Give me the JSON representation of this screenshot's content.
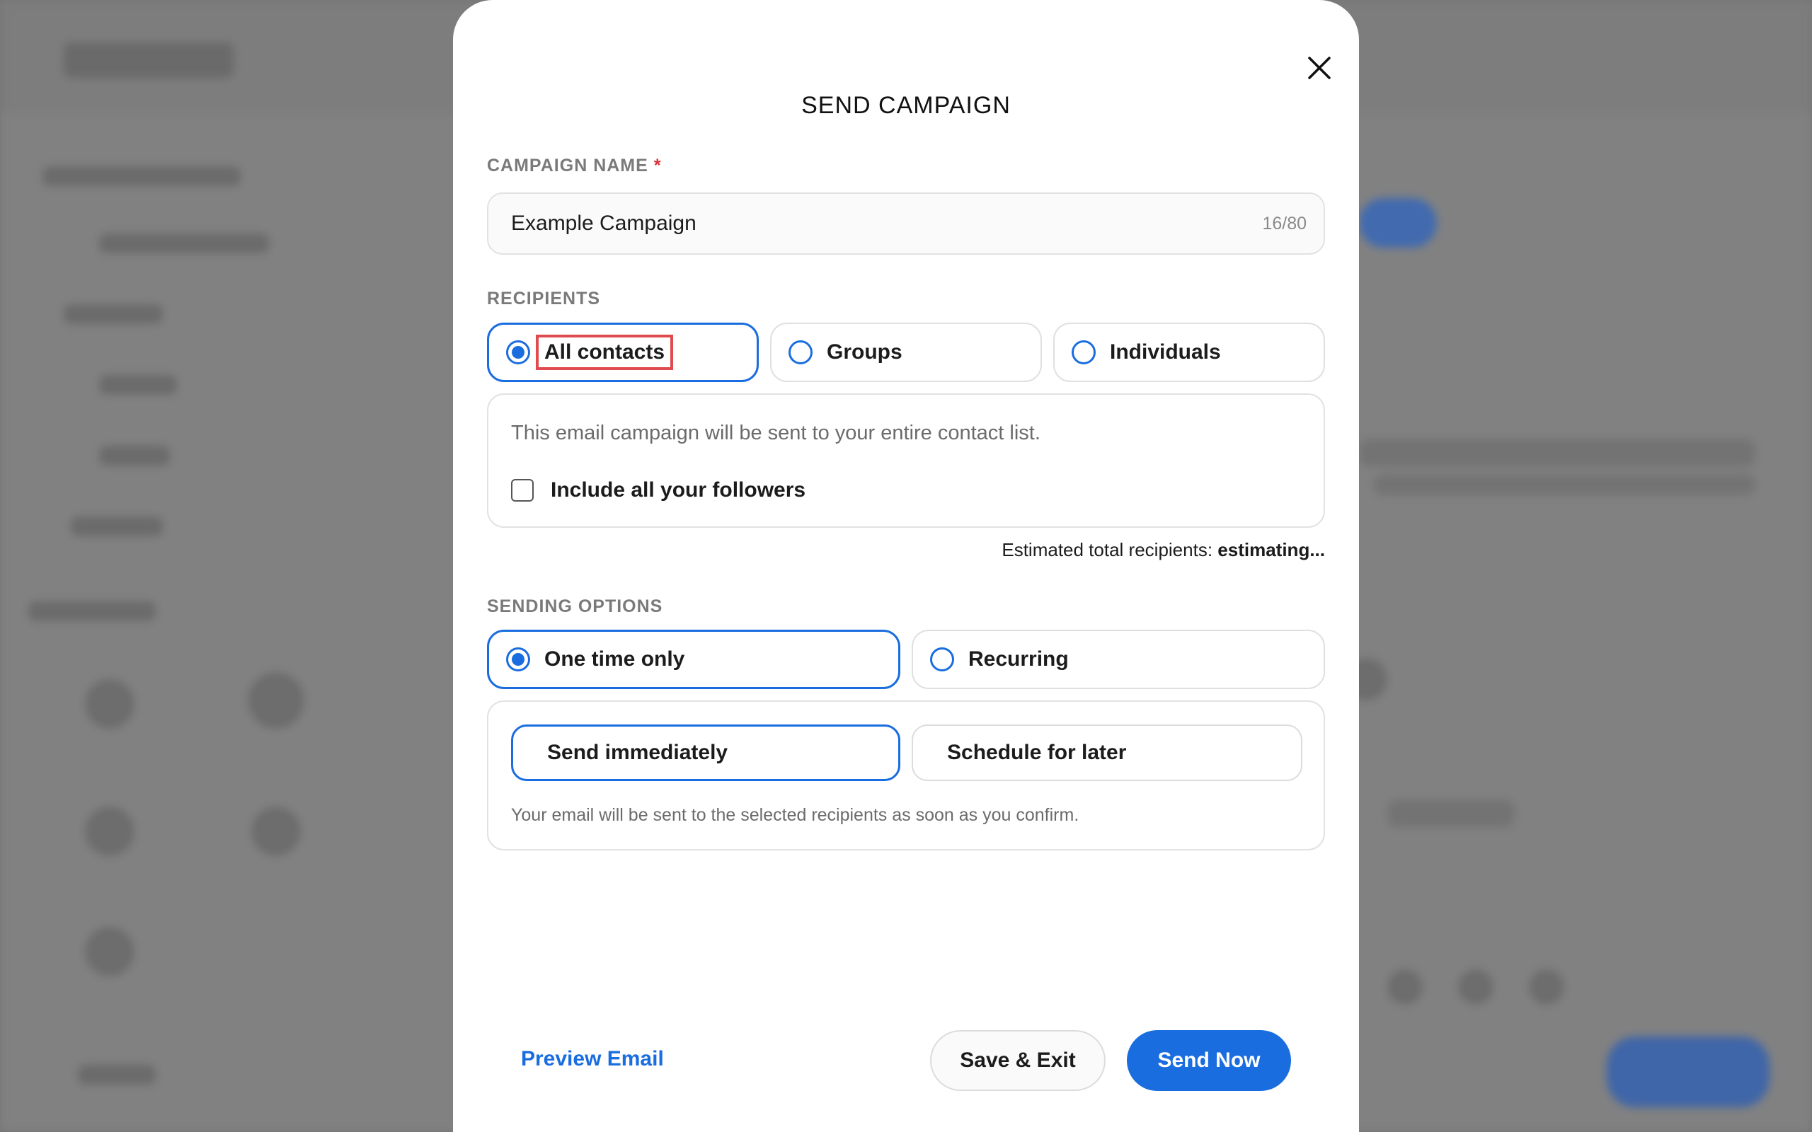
{
  "modal": {
    "title": "SEND CAMPAIGN",
    "close_icon": "close-icon"
  },
  "campaign_name": {
    "label": "CAMPAIGN NAME",
    "required_mark": "*",
    "value": "Example Campaign",
    "char_count": "16/80"
  },
  "recipients": {
    "label": "RECIPIENTS",
    "options": [
      {
        "label": "All contacts",
        "selected": true
      },
      {
        "label": "Groups",
        "selected": false
      },
      {
        "label": "Individuals",
        "selected": false
      }
    ],
    "description": "This email campaign will be sent to your entire contact list.",
    "include_followers_label": "Include all your followers",
    "include_followers_checked": false,
    "estimate_label": "Estimated total recipients:",
    "estimate_value": "estimating..."
  },
  "sending_options": {
    "label": "SENDING OPTIONS",
    "frequency": [
      {
        "label": "One time only",
        "selected": true
      },
      {
        "label": "Recurring",
        "selected": false
      }
    ],
    "timing": [
      {
        "label": "Send immediately",
        "selected": true
      },
      {
        "label": "Schedule for later",
        "selected": false
      }
    ],
    "note": "Your email will be sent to the selected recipients as soon as you confirm."
  },
  "footer": {
    "preview_label": "Preview Email",
    "save_label": "Save & Exit",
    "send_label": "Send Now"
  },
  "colors": {
    "accent": "#1a6ddf",
    "required": "#d9323b",
    "highlight": "#e04b4f"
  }
}
